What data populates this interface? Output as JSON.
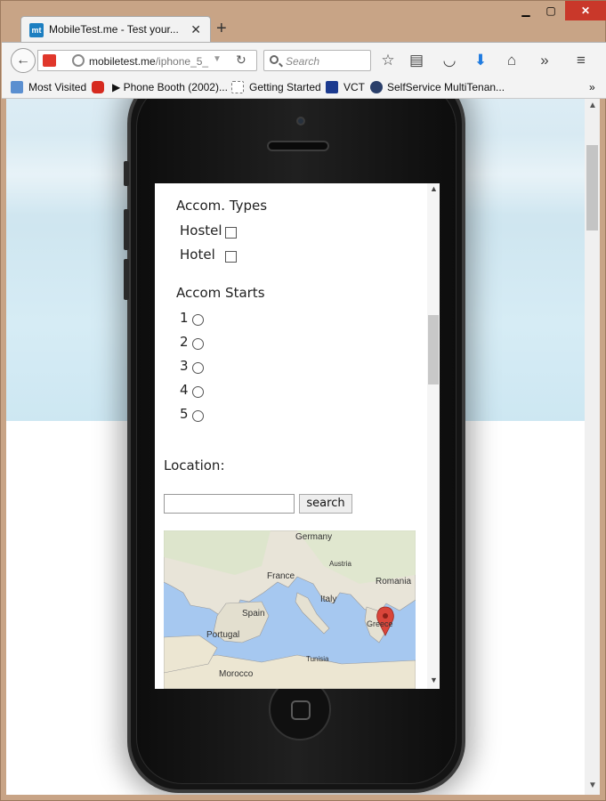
{
  "browser": {
    "tab_title": "MobileTest.me - Test your...",
    "tab_favicon": "mt",
    "url_domain": "mobiletest.me",
    "url_path": "/iphone_5_",
    "search_placeholder": "Search",
    "bookmarks": [
      {
        "label": "Most Visited",
        "icon": "most-visited-icon"
      },
      {
        "label": "▶ Phone Booth (2002)...",
        "icon": "youtube-icon"
      },
      {
        "label": "Getting Started",
        "icon": "page-icon"
      },
      {
        "label": "VCT",
        "icon": "eu-flag-icon"
      },
      {
        "label": "SelfService MultiTenan...",
        "icon": "agent-icon"
      }
    ]
  },
  "mobile_page": {
    "accom_types_heading": "Accom. Types",
    "accom_types": [
      "Hostel",
      "Hotel"
    ],
    "accom_stars_heading": "Accom Starts",
    "stars": [
      "1",
      "2",
      "3",
      "4",
      "5"
    ],
    "location_label": "Location:",
    "location_input_value": "",
    "search_button": "search",
    "map_labels": [
      "Germany",
      "Austria",
      "France",
      "Romania",
      "Italy",
      "Spain",
      "Portugal",
      "Greece",
      "Tunisia",
      "Morocco"
    ]
  },
  "colors": {
    "close_button": "#c9382a",
    "map_water": "#a6c8f0",
    "map_land": "#e8e4d8",
    "marker": "#d9453a"
  }
}
